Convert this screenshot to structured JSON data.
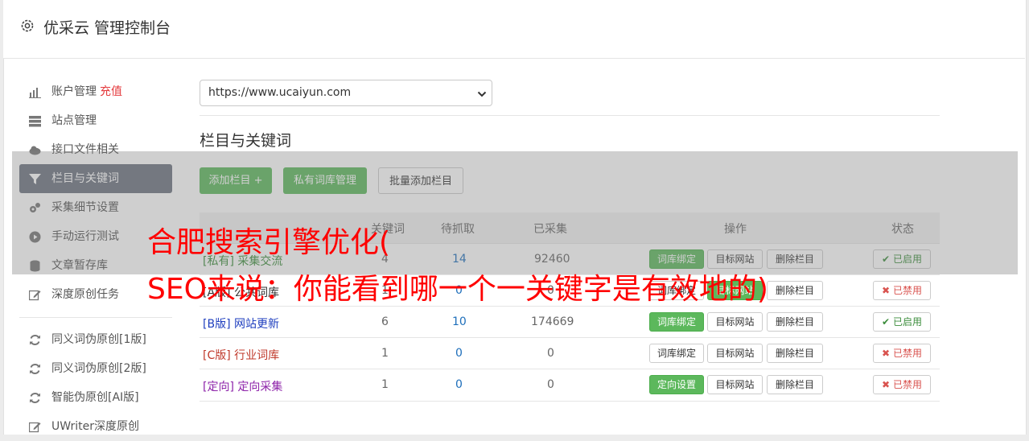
{
  "header": {
    "title": "优采云 管理控制台"
  },
  "sidebar": {
    "items": [
      {
        "label": "账户管理",
        "extra": "充值",
        "icon": "bar-chart-icon"
      },
      {
        "label": "站点管理",
        "icon": "server-icon"
      },
      {
        "label": "接口文件相关",
        "icon": "cloud-upload-icon"
      },
      {
        "label": "栏目与关键词",
        "icon": "filter-icon",
        "active": true
      },
      {
        "label": "采集细节设置",
        "icon": "cogs-icon"
      },
      {
        "label": "手动运行测试",
        "icon": "play-circle-icon"
      },
      {
        "label": "文章暂存库",
        "icon": "database-icon"
      },
      {
        "label": "深度原创任务",
        "icon": "edit-icon"
      }
    ],
    "items2": [
      {
        "label": "同义词伪原创[1版]",
        "icon": "refresh-icon"
      },
      {
        "label": "同义词伪原创[2版]",
        "icon": "refresh-icon"
      },
      {
        "label": "智能伪原创[AI版]",
        "icon": "refresh-icon"
      },
      {
        "label": "UWriter深度原创",
        "icon": "edit-icon"
      }
    ]
  },
  "site_select": {
    "value": "https://www.ucaiyun.com"
  },
  "section": {
    "title": "栏目与关键词"
  },
  "toolbar": {
    "add_column": "添加栏目 +",
    "private_lib": "私有词库管理",
    "bulk_add": "批量添加栏目"
  },
  "table": {
    "headers": {
      "keywords": "关键词",
      "pending": "待抓取",
      "collected": "已采集",
      "actions": "操作",
      "status": "状态"
    },
    "rows": [
      {
        "tag": "[私有]",
        "name": "采集交流",
        "tag_color": "#3c8d3c",
        "keywords": "4",
        "pending": "14",
        "collected": "92460",
        "action1": "词库绑定",
        "action1_style": "green",
        "action2": "目标网站",
        "action3": "删除栏目",
        "status": "已启用",
        "enabled": true
      },
      {
        "tag": "[A版]",
        "name": "公共词库",
        "tag_color": "#333333",
        "keywords": "1",
        "pending": "0",
        "collected": "0",
        "action1": "词库绑定",
        "action1_style": "default",
        "action2": "目标网站",
        "action2_style": "green",
        "action3": "删除栏目",
        "status": "已禁用",
        "enabled": false
      },
      {
        "tag": "[B版]",
        "name": "网站更新",
        "tag_color": "#1f3fbf",
        "keywords": "6",
        "pending": "10",
        "collected": "174669",
        "action1": "词库绑定",
        "action1_style": "green",
        "action2": "目标网站",
        "action3": "删除栏目",
        "status": "已启用",
        "enabled": true
      },
      {
        "tag": "[C版]",
        "name": "行业词库",
        "tag_color": "#c0392b",
        "keywords": "1",
        "pending": "0",
        "collected": "0",
        "action1": "词库绑定",
        "action1_style": "default",
        "action2": "目标网站",
        "action3": "删除栏目",
        "status": "已禁用",
        "enabled": false
      },
      {
        "tag": "[定向]",
        "name": "定向采集",
        "tag_color": "#8e24aa",
        "keywords": "1",
        "pending": "0",
        "collected": "0",
        "action1": "定向设置",
        "action1_style": "green",
        "action2": "目标网站",
        "action3": "删除栏目",
        "status": "已禁用",
        "enabled": false
      }
    ]
  },
  "overlay": {
    "line1": "合肥搜索引擎优化(",
    "line2": "SEO来说：你能看到哪一个一关键字是有效地的)"
  }
}
